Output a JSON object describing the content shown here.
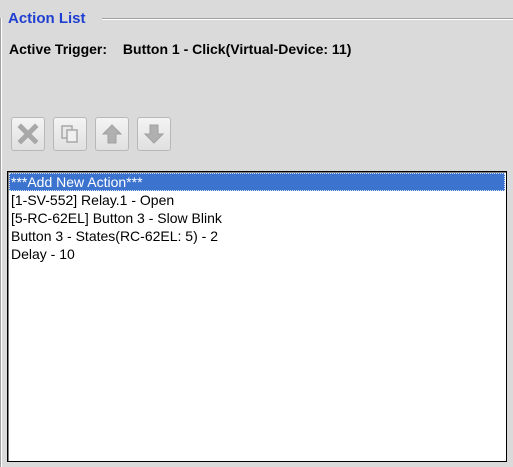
{
  "group": {
    "title": "Action List"
  },
  "trigger": {
    "label": "Active Trigger:",
    "value": "Button 1 - Click(Virtual-Device: 11)"
  },
  "toolbar": {
    "buttons": [
      {
        "icon": "delete-x-icon",
        "enabled": false
      },
      {
        "icon": "copy-icon",
        "enabled": false
      },
      {
        "icon": "arrow-up-icon",
        "enabled": false
      },
      {
        "icon": "arrow-down-icon",
        "enabled": false
      }
    ]
  },
  "list": {
    "items": [
      "***Add New Action***",
      "[1-SV-552] Relay.1 - Open",
      "[5-RC-62EL] Button 3 - Slow Blink",
      "Button 3 - States(RC-62EL: 5) - 2",
      "Delay - 10"
    ],
    "selected_index": 0
  },
  "colors": {
    "title": "#1f3fd0",
    "selection": "#3b73cf",
    "disabled_icon": "#a8a8a8"
  }
}
